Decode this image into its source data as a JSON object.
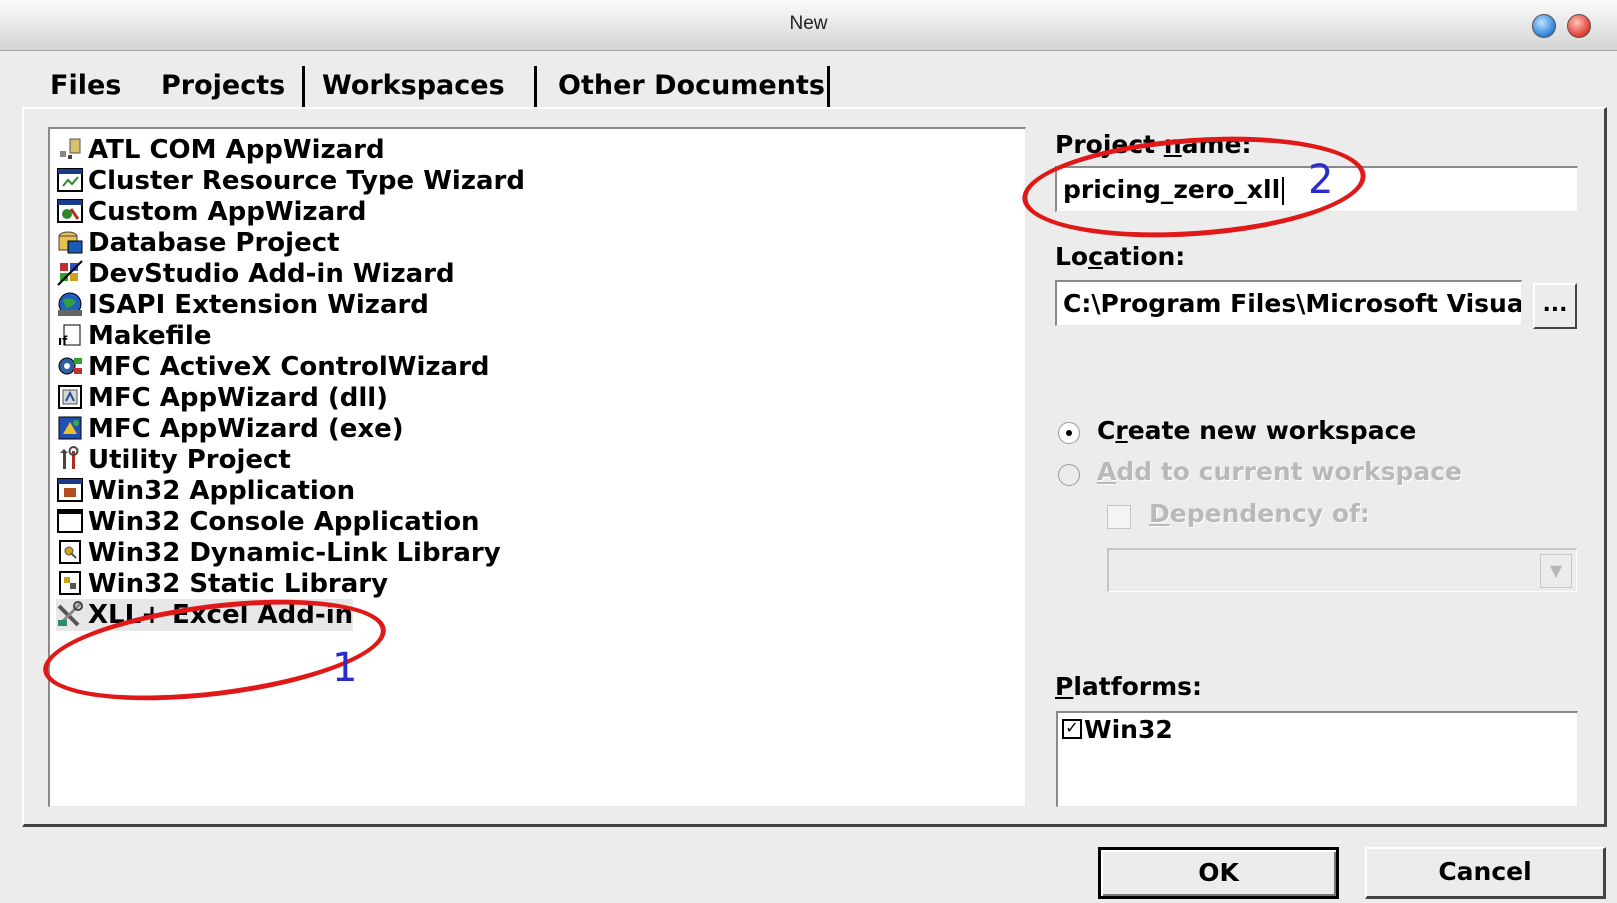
{
  "window": {
    "title": "New"
  },
  "tabs": [
    {
      "label": "Files"
    },
    {
      "label": "Projects"
    },
    {
      "label": "Workspaces"
    },
    {
      "label": "Other Documents"
    }
  ],
  "projects": [
    {
      "label": "ATL COM AppWizard",
      "icon": "atl-com-icon"
    },
    {
      "label": "Cluster Resource Type Wizard",
      "icon": "cluster-wizard-icon"
    },
    {
      "label": "Custom AppWizard",
      "icon": "custom-appwizard-icon"
    },
    {
      "label": "Database Project",
      "icon": "database-icon"
    },
    {
      "label": "DevStudio Add-in Wizard",
      "icon": "devstudio-addin-icon"
    },
    {
      "label": "ISAPI Extension Wizard",
      "icon": "isapi-globe-icon"
    },
    {
      "label": "Makefile",
      "icon": "makefile-icon"
    },
    {
      "label": "MFC ActiveX ControlWizard",
      "icon": "activex-icon"
    },
    {
      "label": "MFC AppWizard (dll)",
      "icon": "mfc-dll-icon"
    },
    {
      "label": "MFC AppWizard (exe)",
      "icon": "mfc-exe-icon"
    },
    {
      "label": "Utility Project",
      "icon": "utility-tools-icon"
    },
    {
      "label": "Win32 Application",
      "icon": "win32-app-icon"
    },
    {
      "label": "Win32 Console Application",
      "icon": "console-window-icon"
    },
    {
      "label": "Win32 Dynamic-Link Library",
      "icon": "dll-icon"
    },
    {
      "label": "Win32 Static Library",
      "icon": "static-lib-icon"
    },
    {
      "label": "XLL+ Excel Add-in",
      "icon": "xll-tools-icon",
      "selected": true
    }
  ],
  "form": {
    "project_name_label_pre": "Project ",
    "project_name_label_u": "n",
    "project_name_label_post": "ame:",
    "project_name_value": "pricing_zero_xll",
    "location_label_pre": "Lo",
    "location_label_u": "c",
    "location_label_post": "ation:",
    "location_value": "C:\\Program Files\\Microsoft Visua",
    "browse_label": "...",
    "create_new_pre": "C",
    "create_new_u": "r",
    "create_new_post": "eate new workspace",
    "add_current_pre": "",
    "add_current_u": "A",
    "add_current_post": "dd to current workspace",
    "dependency_pre": "",
    "dependency_u": "D",
    "dependency_post": "ependency of:",
    "platforms_label_pre": "",
    "platforms_label_u": "P",
    "platforms_label_post": "latforms:",
    "platform_items": [
      {
        "label": "Win32",
        "checked": true
      }
    ]
  },
  "buttons": {
    "ok": "OK",
    "cancel": "Cancel"
  },
  "annotations": [
    {
      "number": "1"
    },
    {
      "number": "2"
    }
  ],
  "colors": {
    "annotation_circle": "#e01818",
    "annotation_number": "#2c2cc8"
  }
}
